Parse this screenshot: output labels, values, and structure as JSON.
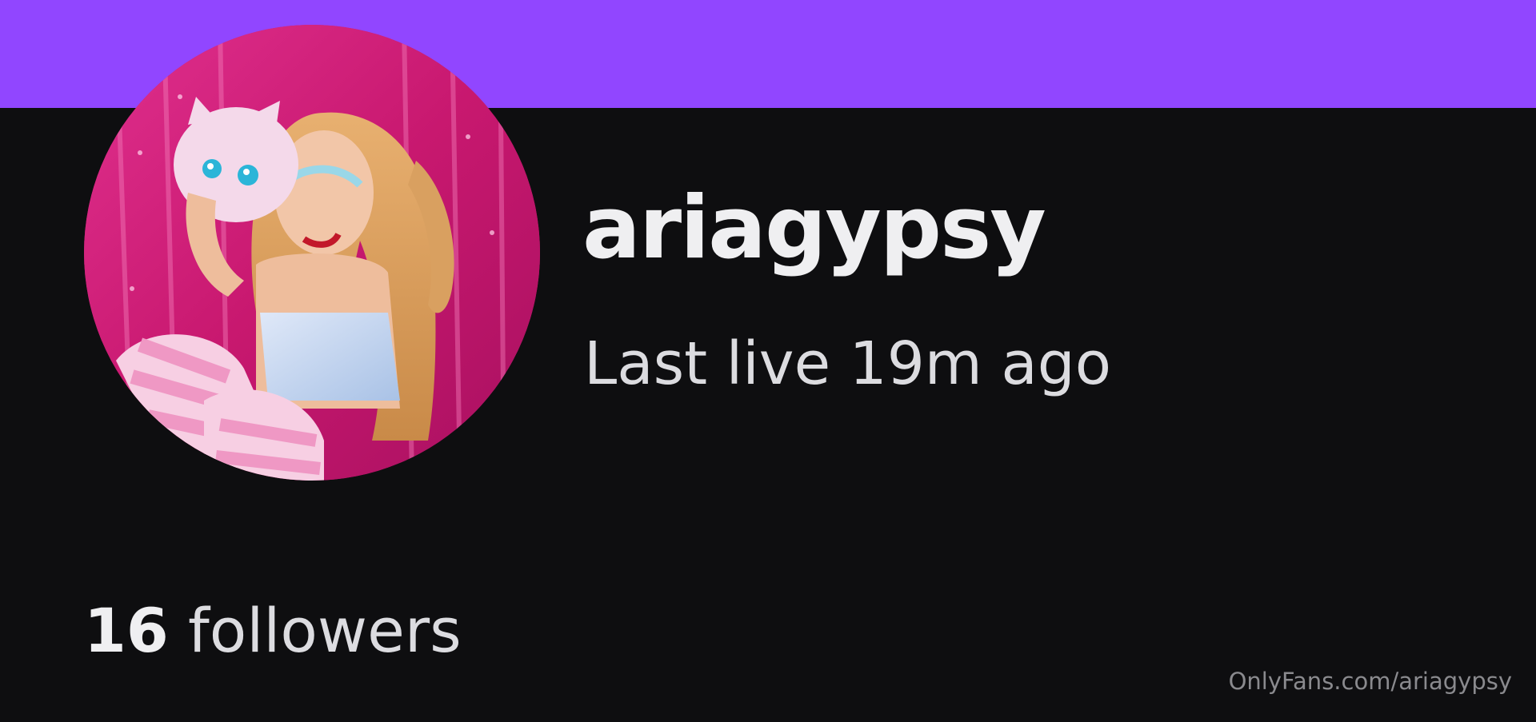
{
  "theme": {
    "banner_color": "#9146ff",
    "background_color": "#0e0e10",
    "text_color": "#efeff1",
    "watermark_color": "#8a8a8e"
  },
  "profile": {
    "username": "ariagypsy",
    "last_live": "Last live 19m ago",
    "avatar_icon": "avatar-photo"
  },
  "stats": {
    "followers_count": "16",
    "followers_label": "followers"
  },
  "watermark": {
    "text": "OnlyFans.com/ariagypsy"
  }
}
